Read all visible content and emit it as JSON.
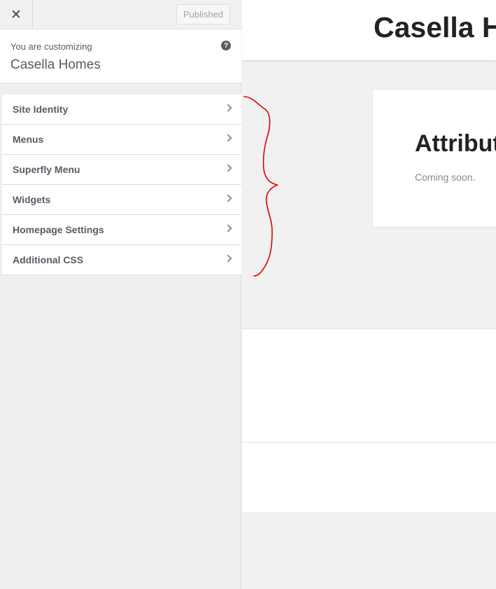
{
  "topbar": {
    "close_glyph": "✕",
    "publish_label": "Published"
  },
  "info": {
    "label": "You are customizing",
    "site_name": "Casella Homes",
    "help_glyph": "?"
  },
  "menu": {
    "items": [
      {
        "label": "Site Identity"
      },
      {
        "label": "Menus"
      },
      {
        "label": "Superfly Menu"
      },
      {
        "label": "Widgets"
      },
      {
        "label": "Homepage Settings"
      },
      {
        "label": "Additional CSS"
      }
    ]
  },
  "preview": {
    "site_title": "Casella H",
    "card_title": "Attribut",
    "card_text": "Coming soon."
  },
  "colors": {
    "annotation": "#e00000",
    "sidebar_bg": "#eeeeee",
    "text": "#555d66"
  },
  "icons": [
    "close-icon",
    "help-icon",
    "chevron-right-icon"
  ]
}
